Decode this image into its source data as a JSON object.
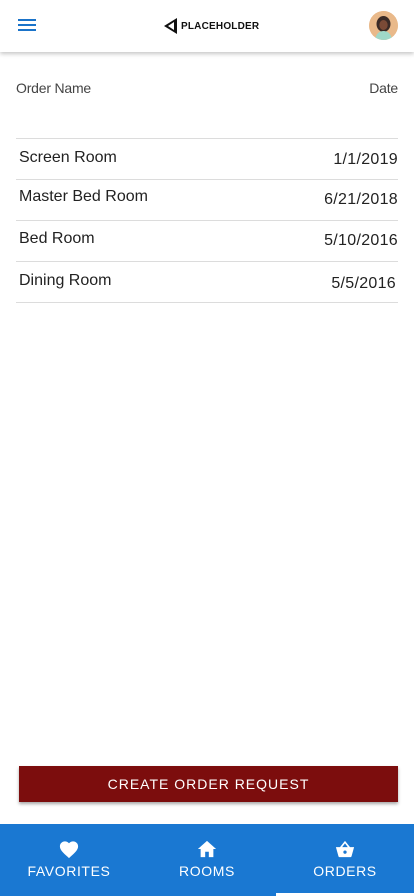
{
  "header": {
    "logo_text": "PLACEHOLDER",
    "menu_icon": "menu-icon",
    "avatar_icon": "avatar"
  },
  "table": {
    "columns": {
      "name": "Order Name",
      "date": "Date"
    },
    "rows": [
      {
        "name": "Screen Room",
        "date": "1/1/2019"
      },
      {
        "name": "Master Bed Room",
        "date": "6/21/2018"
      },
      {
        "name": "Bed Room",
        "date": "5/10/2016"
      },
      {
        "name": "Dining Room",
        "date": "5/5/2016"
      }
    ]
  },
  "actions": {
    "create_label": "CREATE ORDER REQUEST"
  },
  "nav": {
    "items": [
      {
        "label": "FAVORITES",
        "icon": "heart-icon",
        "active": false
      },
      {
        "label": "ROOMS",
        "icon": "home-icon",
        "active": false
      },
      {
        "label": "ORDERS",
        "icon": "basket-icon",
        "active": true
      }
    ]
  },
  "colors": {
    "accent": "#1a78d2",
    "menu_icon": "#1a73c9",
    "primary_button": "#7c0d0d",
    "divider": "#dcdcdc"
  }
}
